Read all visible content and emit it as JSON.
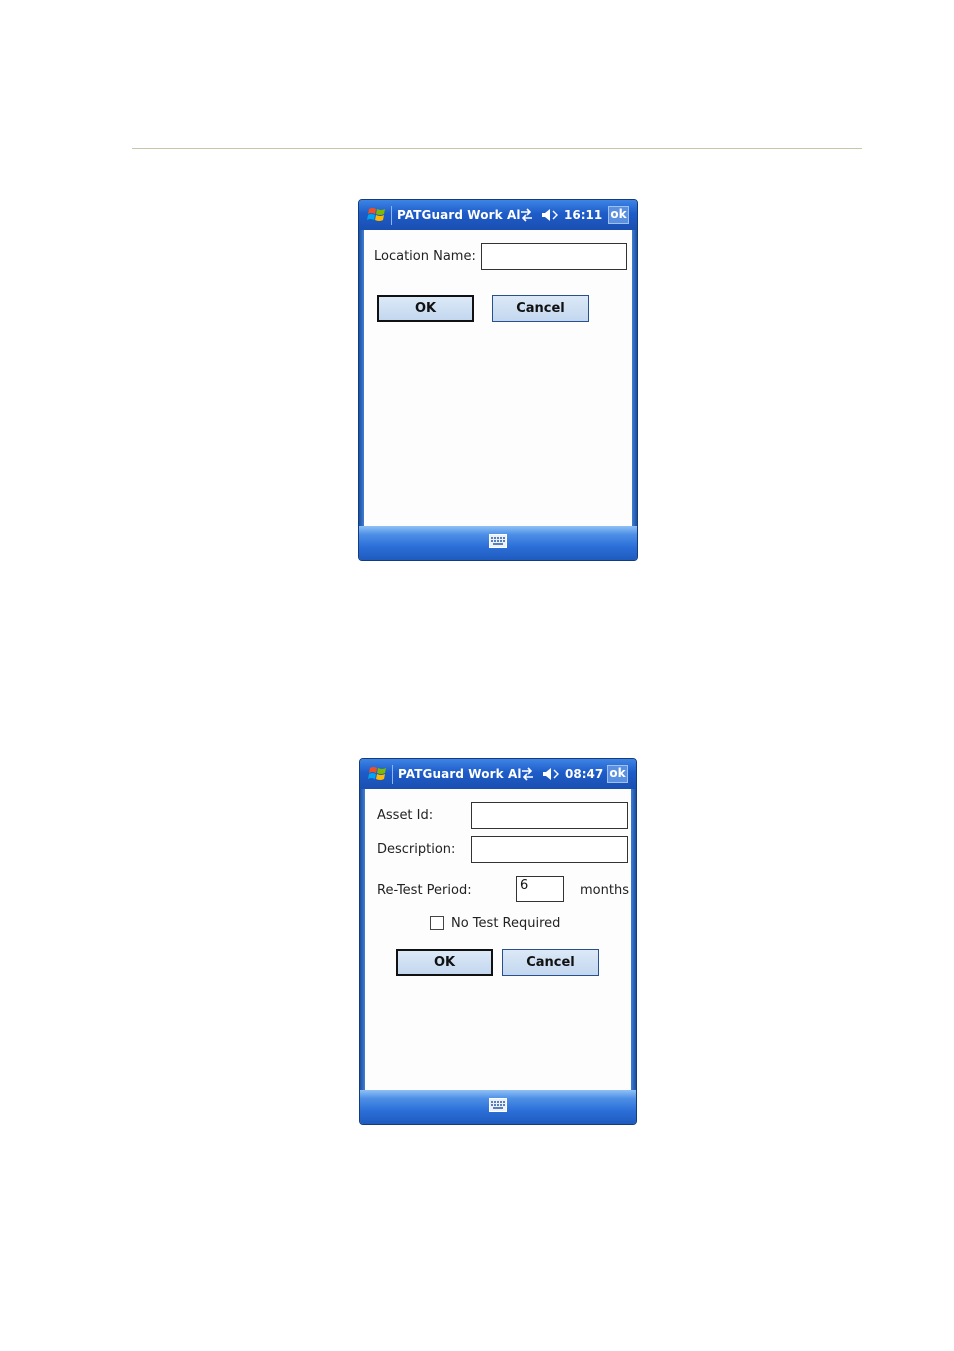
{
  "screen1": {
    "app_title": "PATGuard Work Al",
    "clock": "16:11",
    "ok_label": "ok",
    "location_label": "Location Name:",
    "location_value": "",
    "ok_button": "OK",
    "cancel_button": "Cancel"
  },
  "screen2": {
    "app_title": "PATGuard Work Al",
    "clock": "08:47",
    "ok_label": "ok",
    "asset_id_label": "Asset Id:",
    "asset_id_value": "",
    "description_label": "Description:",
    "description_value": "",
    "retest_label": "Re-Test Period:",
    "retest_value": "6",
    "months_label": "months",
    "no_test_label": "No Test Required",
    "no_test_checked": false,
    "ok_button": "OK",
    "cancel_button": "Cancel"
  },
  "icons": {
    "start": "windows-flag-icon",
    "connectivity": "connectivity-arrows-icon",
    "volume": "speaker-volume-icon",
    "keyboard": "keyboard-icon",
    "checkbox": "checkbox-icon"
  },
  "colors": {
    "titlebar": "#1e5cc8",
    "button_fill": "#c3d7ef",
    "rule": "#c9c5a8"
  }
}
